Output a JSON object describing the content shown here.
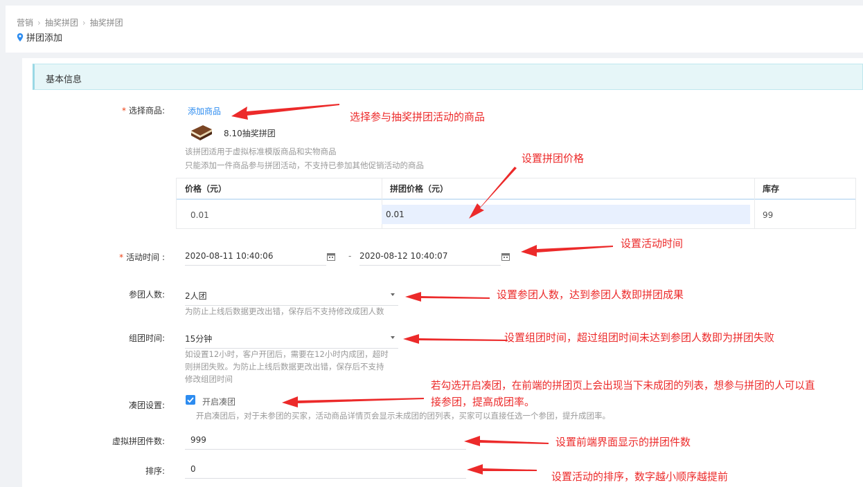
{
  "breadcrumb": [
    "营销",
    "抽奖拼团",
    "抽奖拼团"
  ],
  "page_title": "拼团添加",
  "section_title": "基本信息",
  "form": {
    "product": {
      "label": "选择商品:",
      "add_link": "添加商品",
      "product_name": "8.10抽奖拼团",
      "hint_line1": "该拼团适用于虚拟标准模版商品和实物商品",
      "hint_line2": "只能添加一件商品参与拼团活动，不支持已参加其他促销活动的商品"
    },
    "price_table": {
      "headers": [
        "价格（元）",
        "拼团价格（元）",
        "库存"
      ],
      "row": [
        "0.01",
        "0.01",
        "99"
      ]
    },
    "activity_time": {
      "label": "活动时间 :",
      "start": "2020-08-11 10:40:06",
      "separator": "-",
      "end": "2020-08-12 10:40:07"
    },
    "group_size": {
      "label": "参团人数:",
      "value": "2人团",
      "hint": "为防止上线后数据更改出错，保存后不支持修改成团人数"
    },
    "group_time": {
      "label": "组团时间:",
      "value": "15分钟",
      "hint_line1": "如设置12小时，客户开团后，需要在12小时内成团，超时",
      "hint_line2": "则拼团失败。为防止上线后数据更改出错，保存后不支持",
      "hint_line3": "修改组团时间"
    },
    "gather": {
      "label": "凑团设置:",
      "checkbox_label": "开启凑团",
      "checked": true,
      "hint": "开启凑团后，对于未参团的买家，活动商品详情页会显示未成团的团列表，买家可以直接任选一个参团，提升成团率。"
    },
    "virtual_count": {
      "label": "虚拟拼团件数:",
      "value": "999"
    },
    "sort": {
      "label": "排序:",
      "value": "0"
    }
  },
  "annotations": {
    "product": "选择参与抽奖拼团活动的商品",
    "group_price": "设置拼团价格",
    "activity_time": "设置活动时间",
    "group_size": "设置参团人数，达到参团人数即拼团成果",
    "group_time": "设置组团时间，超过组团时间未达到参团人数即为拼团失败",
    "gather_line1": "若勾选开启凑团，在前端的拼团页上会出现当下未成团的列表，想参与拼团的人可以直",
    "gather_line2": "接参团，提高成团率。",
    "virtual_count": "设置前端界面显示的拼团件数",
    "sort": "设置活动的排序，数字越小顺序越提前"
  },
  "colors": {
    "accent": "#2d8cf0",
    "required": "#ed4014",
    "annotation": "#ec2a2a",
    "section_bg": "#e6f6f8"
  }
}
